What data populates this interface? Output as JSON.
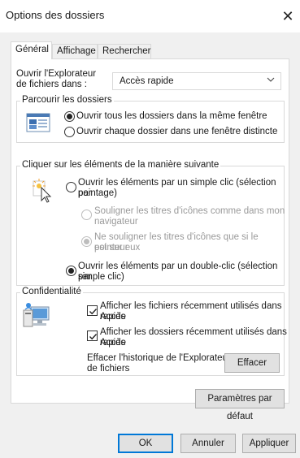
{
  "window": {
    "title": "Options des dossiers",
    "close_glyph": "✕"
  },
  "tabs": [
    {
      "label": "Général",
      "active": true
    },
    {
      "label": "Affichage",
      "active": false
    },
    {
      "label": "Rechercher",
      "active": false
    }
  ],
  "open_explorer": {
    "label_line1": "Ouvrir l'Explorateur",
    "label_line2": "de fichiers dans :",
    "selected": "Accès rapide"
  },
  "browse_group": {
    "title": "Parcourir les dossiers",
    "icon": "folder-window-icon",
    "options": [
      {
        "label": "Ouvrir tous les dossiers dans la même fenêtre",
        "selected": true
      },
      {
        "label": "Ouvrir chaque dossier dans une fenêtre distincte",
        "selected": false
      }
    ]
  },
  "click_group": {
    "title": "Cliquer sur les éléments de la manière suivante",
    "icon": "cursor-click-icon",
    "single_click": {
      "line1": "Ouvrir les éléments par un simple clic (sélection par",
      "line2": "pointage)",
      "selected": false
    },
    "underline_always": {
      "line1": "Souligner les titres d'icônes comme dans mon",
      "line2": "navigateur",
      "selected": false,
      "disabled": true
    },
    "underline_hover": {
      "line1": "Ne souligner les titres d'icônes que si le pointeur",
      "line2": "est sur eux",
      "selected": true,
      "disabled": true
    },
    "double_click": {
      "line1": "Ouvrir les éléments par un double-clic (sélection par",
      "line2": "simple clic)",
      "selected": true
    }
  },
  "privacy_group": {
    "title": "Confidentialité",
    "icon": "privacy-computer-icon",
    "show_recent_files": {
      "line1": "Afficher les fichiers récemment utilisés dans Accès",
      "line2": "rapide",
      "checked": true
    },
    "show_frequent_folders": {
      "line1": "Afficher les dossiers récemment utilisés dans Accès",
      "line2": "rapide",
      "checked": true
    },
    "clear_history": {
      "line1": "Effacer l'historique de l'Explorateur",
      "line2": "de fichiers"
    },
    "clear_button": "Effacer"
  },
  "defaults_button": "Paramètres par défaut",
  "footer": {
    "ok": "OK",
    "cancel": "Annuler",
    "apply": "Appliquer"
  },
  "colors": {
    "accent": "#0078d7",
    "panel_border": "#d9d9d9",
    "dialog_bg": "#f0f0f0",
    "disabled_text": "#9a9a9a"
  }
}
